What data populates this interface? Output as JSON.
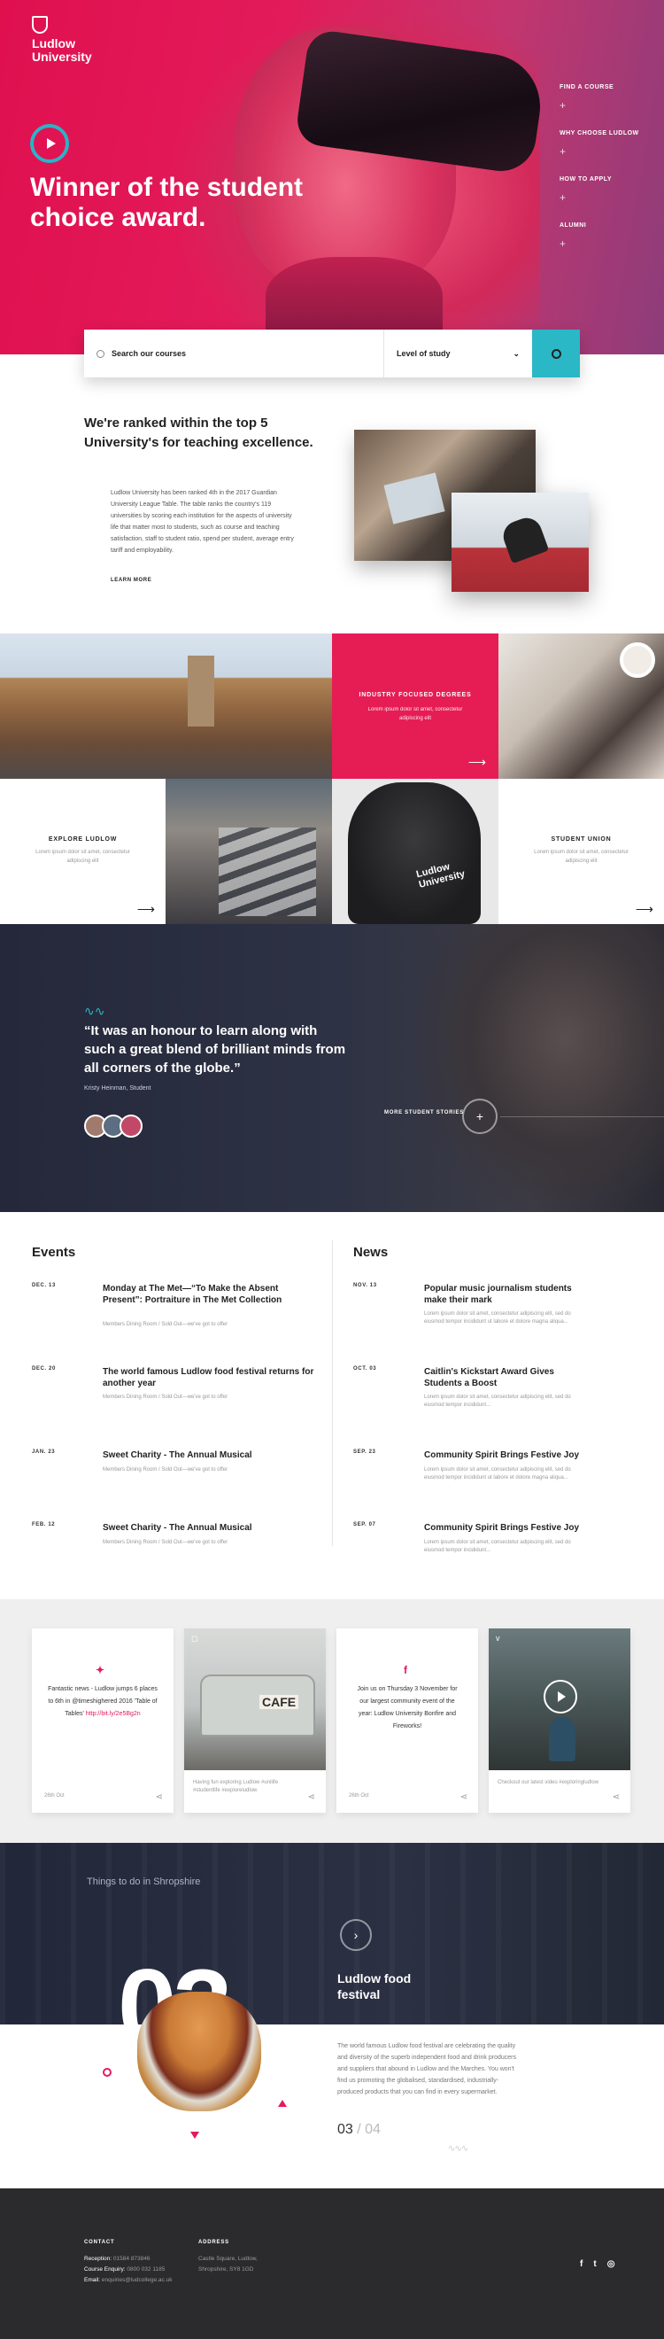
{
  "brand": {
    "name": "Ludlow University"
  },
  "hero": {
    "title": "Winner of the student choice award.",
    "nav": [
      {
        "label": "FIND A COURSE"
      },
      {
        "label": "WHY CHOOSE LUDLOW"
      },
      {
        "label": "HOW TO APPLY"
      },
      {
        "label": "ALUMNI"
      }
    ],
    "plus": "+"
  },
  "search": {
    "placeholder": "Search our courses",
    "level_label": "Level of study",
    "caret": "⌄"
  },
  "ranked": {
    "heading": "We're ranked within the top 5 University's for teaching excellence.",
    "body": "Ludlow University has been ranked 4th in the 2017 Guardian University League Table. The table ranks the country's 119 universities by scoring each institution for the aspects of university life that matter most to students, such as course and teaching satisfaction, staff to student ratio, spend per student, average entry tariff and employability.",
    "link": "LEARN MORE"
  },
  "grid": {
    "industry": {
      "title": "INDUSTRY FOCUSED DEGREES",
      "sub": "Lorem ipsum dolor sit amet, consectetur adipiscing elit"
    },
    "explore": {
      "title": "EXPLORE LUDLOW",
      "sub": "Lorem ipsum dolor sit amet, consectetur adipiscing elit"
    },
    "union": {
      "title": "STUDENT UNION",
      "sub": "Lorem ipsum dolor sit amet, consectetur adipiscing elit"
    },
    "hoodie_text": "Ludlow University",
    "arrow": "⟶"
  },
  "testimonial": {
    "wave": "∿∿",
    "quote": "“It was an honour to learn along with such a great blend of brilliant minds from all corners of the globe.”",
    "author": "Kristy Heinman, Student",
    "more": "MORE STUDENT STORIES",
    "plus": "+"
  },
  "events": {
    "heading": "Events",
    "items": [
      {
        "date": "DEC. 13",
        "title": "Monday at The Met—“To Make the Absent Present”: Portraiture in The Met Collection",
        "meta": "Members Dining Room / Sold Out—we've got to offer"
      },
      {
        "date": "DEC. 20",
        "title": "The world famous Ludlow food festival returns for another year",
        "meta": "Members Dining Room / Sold Out—we've got to offer"
      },
      {
        "date": "JAN. 23",
        "title": "Sweet Charity - The Annual Musical",
        "meta": "Members Dining Room / Sold Out—we've got to offer"
      },
      {
        "date": "FEB. 12",
        "title": "Sweet Charity - The Annual Musical",
        "meta": "Members Dining Room / Sold Out—we've got to offer"
      }
    ]
  },
  "news": {
    "heading": "News",
    "items": [
      {
        "date": "NOV. 13",
        "title": "Popular music journalism students make their mark",
        "meta": "Lorem ipsum dolor sit amet, consectetur adipiscing elit, sed do eiusmod tempor incididunt ut labore et dolore magna aliqua..."
      },
      {
        "date": "OCT. 03",
        "title": "Caitlin's Kickstart Award Gives Students a Boost",
        "meta": "Lorem ipsum dolor sit amet, consectetur adipiscing elit, sed do eiusmod tempor incididunt..."
      },
      {
        "date": "SEP. 23",
        "title": "Community Spirit Brings Festive Joy",
        "meta": "Lorem ipsum dolor sit amet, consectetur adipiscing elit, sed do eiusmod tempor incididunt ut labore et dolore magna aliqua..."
      },
      {
        "date": "SEP. 07",
        "title": "Community Spirit Brings Festive Joy",
        "meta": "Lorem ipsum dolor sit amet, consectetur adipiscing elit, sed do eiusmod tempor incididunt..."
      }
    ]
  },
  "social": {
    "twitter": {
      "icon": "twitter-icon",
      "text": "Fantastic news - Ludlow jumps 6 places to 6th in @timeshighered 2016 'Table of Tables'",
      "link": "http://bit.ly/2e5Bg2n",
      "date": "26th Oct"
    },
    "instagram": {
      "icon": "instagram-icon",
      "caption": "Having fun exploring Ludlow #unilife #studentlife #exploreludlow",
      "sign": "CAFE"
    },
    "facebook": {
      "icon": "facebook-icon",
      "text": "Join us on Thursday 3 November for our largest community event of the year: Ludlow University Bonfire and Fireworks!",
      "date": "26th Oct"
    },
    "vimeo": {
      "icon": "vimeo-icon",
      "caption": "Checkout our latest video #exploringludlow"
    },
    "share": "⋖"
  },
  "shropshire": {
    "label": "Things to do in Shropshire",
    "number": "03",
    "title": "Ludlow food festival",
    "arrow": "›",
    "description": "The world famous Ludlow food festival are celebrating the quality and diversity of the superb independent food and drink producers and suppliers that abound in Ludlow and the Marches. You won't find us promoting the globalised, standardised, industrially-produced products that you can find in every supermarket.",
    "current": "03",
    "slash": " / ",
    "total": "04",
    "squiggle": "∿∿∿"
  },
  "footer": {
    "contact_heading": "CONTACT",
    "contacts": [
      {
        "label": "Reception:",
        "value": "01584 873846"
      },
      {
        "label": "Course Enquiry:",
        "value": "0800 032 1185"
      },
      {
        "label": "Email:",
        "value": "enquiries@ludcollege.ac.uk"
      }
    ],
    "address_heading": "ADDRESS",
    "address_lines": [
      "Castle Square, Ludlow,",
      "Shropshire, SY8 1GD"
    ],
    "social": [
      "f",
      "t",
      "◎"
    ]
  },
  "colors": {
    "accent": "#e31b5a",
    "teal": "#2ab7c6",
    "dark": "#2b2b2d"
  }
}
